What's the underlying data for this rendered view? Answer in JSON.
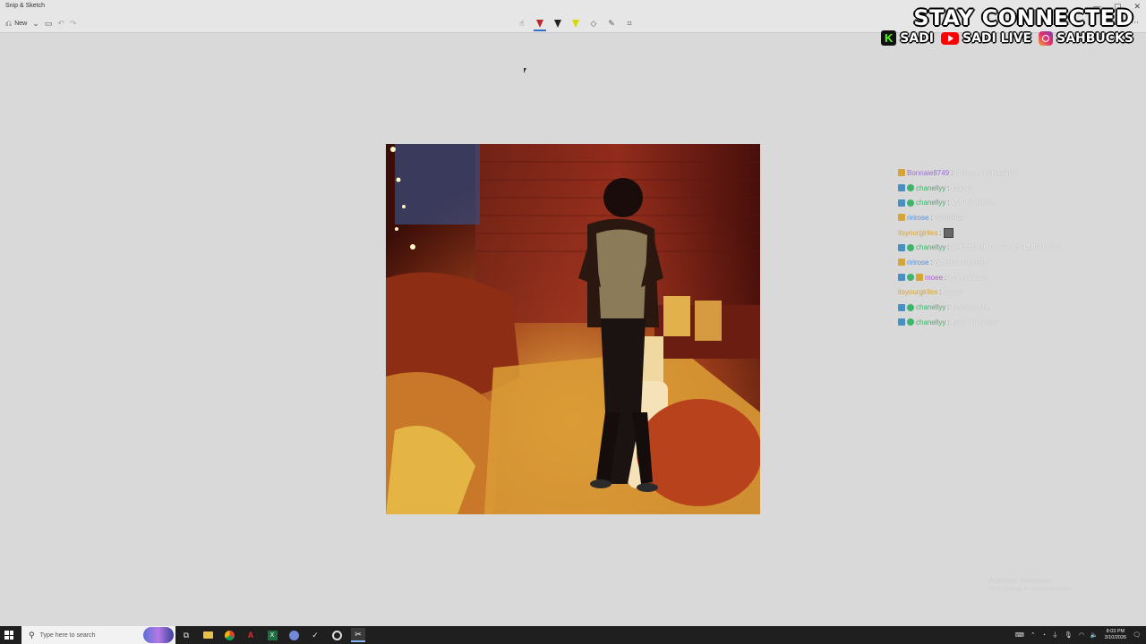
{
  "window": {
    "title": "Snip & Sketch",
    "controls": [
      "—",
      "▢",
      "✕"
    ]
  },
  "toolbar": {
    "new_label": "New",
    "new_icon": "new-snip-icon",
    "tools": [
      "touch-writing-icon",
      "ballpoint-pen-icon",
      "pencil-icon",
      "highlighter-icon",
      "eraser-icon",
      "ruler-icon",
      "crop-icon"
    ],
    "active_tool": "ballpoint-pen-icon",
    "pen_colors": {
      "ballpoint": "#c0272d",
      "pencil": "#222222",
      "highlighter": "#e8e800"
    }
  },
  "overlay": {
    "title": "STAY CONNECTED",
    "socials": [
      {
        "icon": "kick-icon",
        "label": "SADI"
      },
      {
        "icon": "youtube-icon",
        "label": "SADI LIVE"
      },
      {
        "icon": "instagram-icon",
        "label": "SAHBUCKS"
      }
    ]
  },
  "chat": [
    {
      "badges": [
        "gold"
      ],
      "user": "Bonnaie8749",
      "color": "#9b6fd0",
      "message": "chinese and asian?"
    },
    {
      "badges": [
        "blue",
        "green"
      ],
      "user": "chanellyy",
      "color": "#3fb46b",
      "message": "thanku"
    },
    {
      "badges": [
        "blue",
        "green"
      ],
      "user": "chanellyy",
      "color": "#3fb46b",
      "message": "LMFOAOAOA"
    },
    {
      "badges": [
        "gold"
      ],
      "user": "ririrose",
      "color": "#5a8fd6",
      "message": "😩😩😩😩"
    },
    {
      "badges": [],
      "user": "itsyourgirlles",
      "color": "#d6a53a",
      "message": ""
    },
    {
      "badges": [
        "blue",
        "green"
      ],
      "user": "chanellyy",
      "color": "#3fb46b",
      "message": "SHE LOOK DA SAME LMFAOOA\\"
    },
    {
      "badges": [
        "gold"
      ],
      "user": "ririrose",
      "color": "#5a8fd6",
      "message": "different cameras"
    },
    {
      "badges": [
        "blue",
        "green",
        "gold"
      ],
      "user": "moee",
      "color": "#b05ad6",
      "message": "loooooooool"
    },
    {
      "badges": [],
      "user": "itsyourgirlles",
      "color": "#d6a53a",
      "message": "awww"
    },
    {
      "badges": [
        "blue",
        "green"
      ],
      "user": "chanellyy",
      "color": "#3fb46b",
      "message": "moe so cute"
    },
    {
      "badges": [
        "blue",
        "green"
      ],
      "user": "chanellyy",
      "color": "#3fb46b",
      "message": "my pr princess"
    }
  ],
  "activate": {
    "title": "Activate Windows",
    "subtitle": "Go to Settings to activate Windows."
  },
  "taskbar": {
    "search_placeholder": "Type here to search",
    "apps": [
      "task-view-icon",
      "file-explorer-icon",
      "chrome-icon",
      "acrobat-icon",
      "excel-icon",
      "discord-icon",
      "steam-icon",
      "obs-icon",
      "snip-sketch-icon"
    ],
    "active_app": "snip-sketch-icon",
    "time": "8:03 PM",
    "date": "3/10/2026"
  }
}
